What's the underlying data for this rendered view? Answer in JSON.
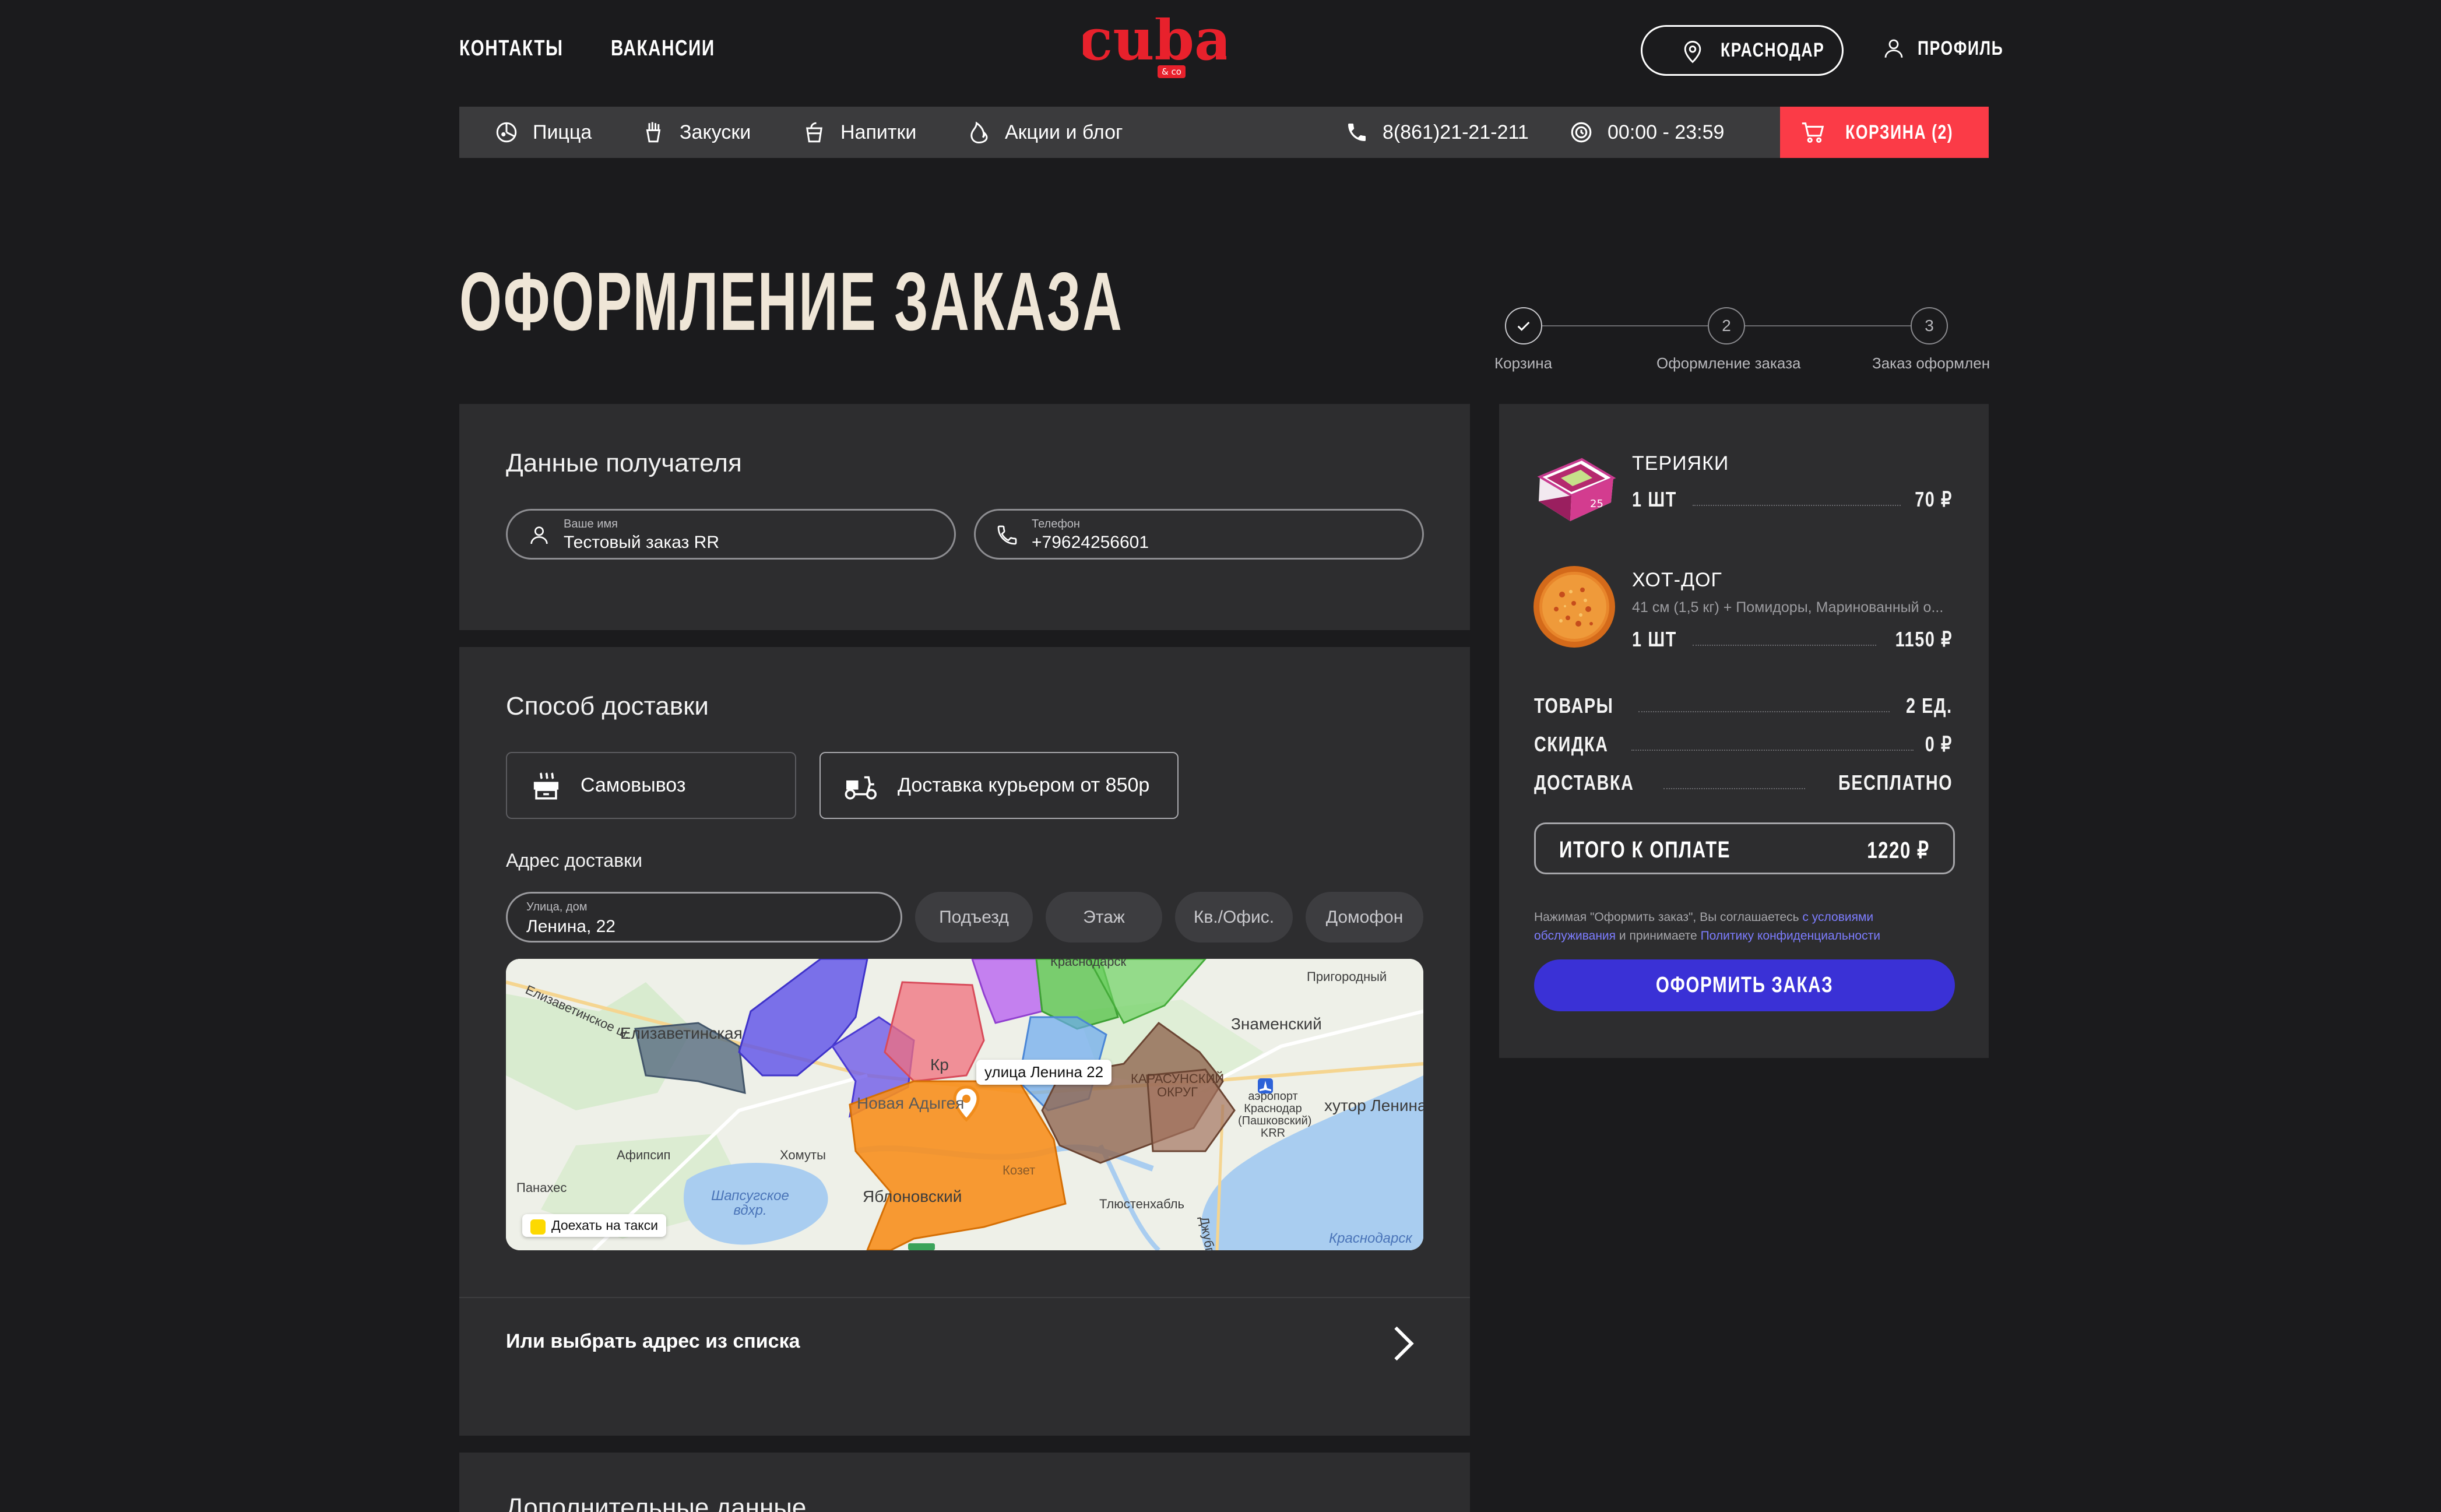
{
  "header": {
    "contacts": "КОНТАКТЫ",
    "vacancies": "ВАКАНСИИ",
    "logo_text": "cuba",
    "logo_sub": "& co",
    "city": "КРАСНОДАР",
    "profile": "ПРОФИЛЬ"
  },
  "nav": {
    "items": [
      "Пицца",
      "Закуски",
      "Напитки",
      "Акции и блог"
    ],
    "phone": "8(861)21-21-211",
    "hours": "00:00 - 23:59",
    "cart": "КОРЗИНА (2)"
  },
  "page": {
    "title": "ОФОРМЛЕНИЕ ЗАКАЗА",
    "steps": [
      {
        "label": "Корзина",
        "mark": "✓"
      },
      {
        "label": "Оформление заказа",
        "mark": "2"
      },
      {
        "label": "Заказ оформлен",
        "mark": "3"
      }
    ]
  },
  "recipient": {
    "title": "Данные получателя",
    "name_label": "Ваше имя",
    "name_value": "Тестовый заказ RR",
    "phone_label": "Телефон",
    "phone_value": "+79624256601"
  },
  "delivery": {
    "title": "Способ доставки",
    "pickup": "Самовывоз",
    "courier": "Доставка курьером от 850р",
    "address_title": "Адрес доставки",
    "street_label": "Улица, дом",
    "street_value": "Ленина, 22",
    "entrance": "Подъезд",
    "floor": "Этаж",
    "apartment": "Кв./Офис.",
    "intercom": "Домофон",
    "pick_from_list": "Или выбрать адрес из списка"
  },
  "map": {
    "pin_label": "улица Ленина 22",
    "taxi_button": "Доехать на такси",
    "places": {
      "elizavetinskaya": "Елизаветинская",
      "elizavetinskoe_sh": "Елизаветинское ш.",
      "krasnodar_top": "Краснодарск",
      "prigorodny": "Пригородный",
      "znamensky": "Знаменский",
      "kr": "Кр",
      "novaya_adygeya": "Новая Адыгея",
      "karasunsky": "КАРАСУНСКИЙ ОКРУГ",
      "airport": "аэропорт Краснодар (Пашковский) KRR",
      "khutor_lenina": "хутор Ленина",
      "afipsip": "Афипсип",
      "khomuty": "Хомуты",
      "kozet": "Козет",
      "panakhes": "Панахес",
      "yablonovsky": "Яблоновский",
      "shapsugskoe": "Шапсугское вдхр.",
      "tlyustenkhabl": "Тлюстенхабль",
      "krasnodar_res": "Краснодарск",
      "dzhubga": "Джубг"
    }
  },
  "additional": {
    "title": "Дополнительные данные"
  },
  "summary": {
    "items": [
      {
        "name": "ТЕРИЯКИ",
        "desc": "",
        "qty": "1 ШТ",
        "price": "70 ₽"
      },
      {
        "name": "ХОТ-ДОГ",
        "desc": "41 см (1,5 кг) + Помидоры, Маринованный о...",
        "qty": "1 ШТ",
        "price": "1150 ₽"
      }
    ],
    "goods_label": "ТОВАРЫ",
    "goods_value": "2 ЕД.",
    "discount_label": "СКИДКА",
    "discount_value": "0 ₽",
    "delivery_label": "ДОСТАВКА",
    "delivery_value": "БЕСПЛАТНО",
    "total_label": "ИТОГО К ОПЛАТЕ",
    "total_value": "1220 ₽",
    "legal_1": "Нажимая \"Оформить заказ\", Вы соглашаетесь ",
    "legal_link_1": "с условиями обслуживания",
    "legal_2": " и принимаете ",
    "legal_link_2": "Политику конфиденциальности",
    "order_button": "ОФОРМИТЬ ЗАКАЗ"
  },
  "colors": {
    "background": "#1b1b1d",
    "panel": "#2d2d2f",
    "accent_red": "#fb3b47",
    "accent_blue": "#3a31d6",
    "title_cream": "#efe6d7"
  }
}
